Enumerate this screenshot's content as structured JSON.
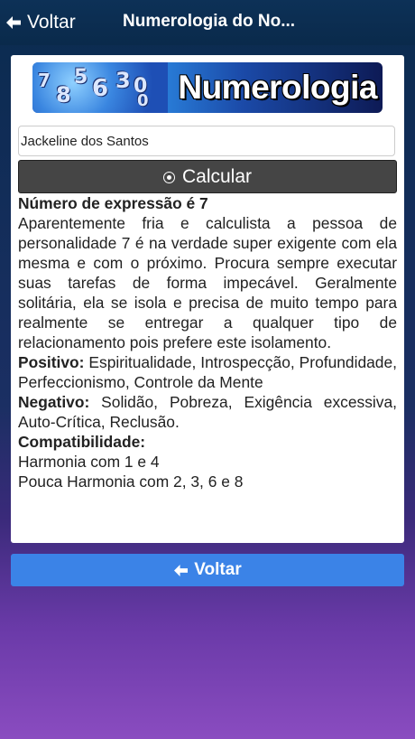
{
  "navbar": {
    "back_label": "Voltar",
    "title": "Numerologia do No..."
  },
  "banner": {
    "digits": [
      "7",
      "8",
      "5",
      "6",
      "3",
      "0",
      "0"
    ],
    "word": "Numerologia"
  },
  "form": {
    "name_value": "Jackeline dos Santos",
    "calculate_label": "Calcular"
  },
  "result": {
    "heading": "Número de expressão é 7",
    "description": "Aparentemente fria e calculista a pessoa de personalidade 7 é na verdade super exigente com ela mesma e com o próximo. Procura sempre executar suas tarefas de forma impecável. Geralmente solitária, ela se isola e precisa de muito tempo para realmente se entregar a qualquer tipo de relacionamento pois prefere este isolamento.",
    "positive_label": "Positivo:",
    "positive_text": "Espiritualidade, Introspecção, Profundidade, Perfeccionismo, Controle da Mente",
    "negative_label": "Negativo:",
    "negative_text": "Solidão, Pobreza, Exigência excessiva, Auto-Crítica, Reclusão.",
    "compat_label": "Compatibilidade:",
    "harmony": "Harmonia com 1 e 4",
    "low_harmony": "Pouca Harmonia com 2, 3, 6 e 8"
  },
  "footer": {
    "back_label": "Voltar"
  },
  "colors": {
    "navbar": "#0a2a4b",
    "calculate_button": "#454545",
    "back_button": "#3b83e7"
  },
  "icons": {
    "nav_back": "arrow-left-icon",
    "calculate": "radio-circle-icon",
    "footer_back": "arrow-left-icon"
  }
}
